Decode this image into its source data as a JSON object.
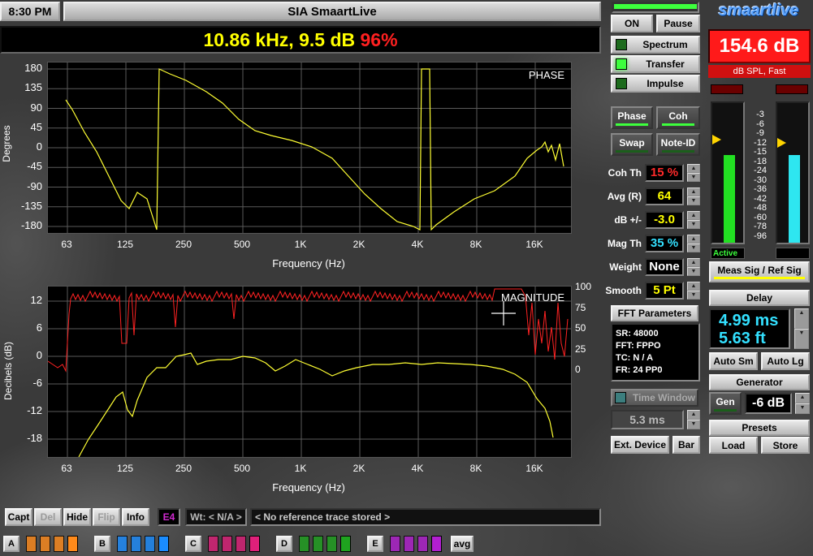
{
  "app": {
    "time": "8:30 PM",
    "title": "SIA SmaartLive",
    "readout_freq": "10.86 kHz, 9.5 dB",
    "readout_sep": ",",
    "readout_coh": " 96%",
    "logo": "smaartlive"
  },
  "spl": {
    "value": "154.6 dB",
    "mode": "dB SPL, Fast"
  },
  "transport": {
    "on": "ON",
    "pause": "Pause"
  },
  "modes": {
    "spectrum": "Spectrum",
    "transfer": "Transfer",
    "impulse": "Impulse"
  },
  "tools": {
    "phase": "Phase",
    "coh": "Coh",
    "swap": "Swap",
    "note_id": "Note-ID"
  },
  "params": [
    {
      "label": "Coh Th",
      "value": "15 %",
      "color": "#ff2a2a"
    },
    {
      "label": "Avg (R)",
      "value": "64",
      "color": "#ffff00"
    },
    {
      "label": "dB +/-",
      "value": "-3.0",
      "color": "#ffff00"
    },
    {
      "label": "Mag Th",
      "value": "35 %",
      "color": "#33e0ff"
    },
    {
      "label": "Weight",
      "value": "None",
      "color": "#ffffff"
    },
    {
      "label": "Smooth",
      "value": "5 Pt",
      "color": "#ffff00"
    }
  ],
  "fft": {
    "title": "FFT Parameters",
    "lines": [
      "SR: 48000",
      "FFT: FPPO",
      "TC: N / A",
      "FR: 24 PP0"
    ]
  },
  "time_window": {
    "label": "Time Window",
    "value": "5.3 ms"
  },
  "ext": {
    "device": "Ext. Device",
    "bar": "Bar"
  },
  "meters": {
    "scale": [
      "-3",
      "-6",
      "-9",
      "-12",
      "-15",
      "-18",
      "-24",
      "-30",
      "-36",
      "-42",
      "-48",
      "-60",
      "-78",
      "-96"
    ],
    "active": "Active",
    "left_level": 0.84,
    "right_level": 0.84,
    "left_color": "#22e022",
    "right_color": "#2ee6f0"
  },
  "meas_ref": "Meas Sig / Ref Sig",
  "delay": {
    "title": "Delay",
    "ms": "4.99 ms",
    "ft": "5.63 ft",
    "auto_sm": "Auto Sm",
    "auto_lg": "Auto Lg"
  },
  "generator": {
    "title": "Generator",
    "gen": "Gen",
    "level": "-6 dB"
  },
  "presets": {
    "title": "Presets",
    "load": "Load",
    "store": "Store"
  },
  "phase_plot": {
    "title": "PHASE",
    "ylabel": "Degrees",
    "xlabel": "Frequency (Hz)",
    "yticks": [
      "180",
      "135",
      "90",
      "45",
      "0",
      "-45",
      "-90",
      "-135",
      "-180"
    ],
    "xticks": [
      "63",
      "125",
      "250",
      "500",
      "1K",
      "2K",
      "4K",
      "8K",
      "16K"
    ]
  },
  "mag_plot": {
    "title": "MAGNITUDE",
    "ylabel": "Decibels (dB)",
    "xlabel": "Frequency (Hz)",
    "yticks": [
      "12",
      "6",
      "0",
      "-6",
      "-12",
      "-18"
    ],
    "rticks": [
      "100",
      "75",
      "50",
      "25",
      "0"
    ],
    "xticks": [
      "63",
      "125",
      "250",
      "500",
      "1K",
      "2K",
      "4K",
      "8K",
      "16K"
    ]
  },
  "bottom": {
    "capt": "Capt",
    "del": "Del",
    "hide": "Hide",
    "flip": "Flip",
    "info": "Info",
    "e4": "E4",
    "wt": "Wt: < N/A >",
    "ref": "< No reference trace stored >",
    "groups": [
      {
        "letter": "A",
        "color": "#ff8a1a"
      },
      {
        "letter": "B",
        "color": "#1a8cff"
      },
      {
        "letter": "C",
        "color": "#e0207a"
      },
      {
        "letter": "D",
        "color": "#1fa31f"
      },
      {
        "letter": "E",
        "color": "#b21fd0"
      }
    ],
    "avg": "avg"
  }
}
